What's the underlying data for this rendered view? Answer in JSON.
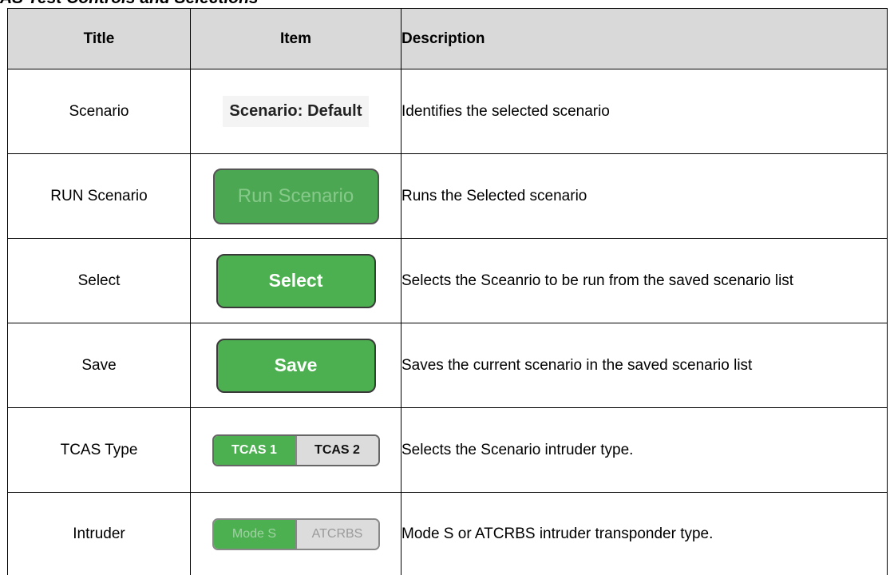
{
  "caption": "AS Test Controls and Selections",
  "headers": {
    "title": "Title",
    "item": "Item",
    "description": "Description"
  },
  "rows": [
    {
      "title": "Scenario",
      "item_text": "Scenario: Default",
      "description": "Identifies the selected scenario"
    },
    {
      "title": "RUN Scenario",
      "item_text": "Run Scenario",
      "description": "Runs the Selected scenario"
    },
    {
      "title": "Select",
      "item_text": "Select",
      "description": "Selects the Sceanrio to be run from the saved scenario list"
    },
    {
      "title": "Save",
      "item_text": "Save",
      "description": "Saves the current scenario in the saved scenario list"
    },
    {
      "title": "TCAS Type",
      "option_a": "TCAS 1",
      "option_b": "TCAS 2",
      "description": "Selects the Scenario intruder type."
    },
    {
      "title": "Intruder",
      "option_a": "Mode S",
      "option_b": "ATCRBS",
      "description": "Mode S or ATCRBS intruder transponder type."
    }
  ],
  "colors": {
    "button_green": "#4caf50",
    "header_gray": "#d9d9d9",
    "segment_off_gray": "#dcdcdc"
  }
}
